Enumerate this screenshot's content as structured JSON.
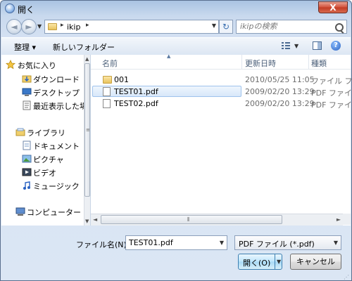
{
  "window": {
    "title": "開く",
    "close_glyph": "X"
  },
  "nav": {
    "back_glyph": "◄",
    "forward_glyph": "►",
    "dropdown_glyph": "▼"
  },
  "address": {
    "separator": "▸",
    "crumb": "ikip",
    "dropdown_glyph": "▼",
    "refresh_glyph": "↻"
  },
  "search": {
    "placeholder": "ikipの検索"
  },
  "toolbar": {
    "organize_label": "整理 ▾",
    "new_folder_label": "新しいフォルダー",
    "view_dropdown_glyph": "▼",
    "help_glyph": "?"
  },
  "navpane": {
    "items": [
      {
        "label": "お気に入り",
        "icon": "star-icon"
      },
      {
        "label": "ダウンロード",
        "icon": "download-folder-icon"
      },
      {
        "label": "デスクトップ",
        "icon": "desktop-icon"
      },
      {
        "label": "最近表示した場所",
        "icon": "recent-places-icon"
      },
      {
        "label": "ライブラリ",
        "icon": "library-icon"
      },
      {
        "label": "ドキュメント",
        "icon": "documents-icon"
      },
      {
        "label": "ピクチャ",
        "icon": "pictures-icon"
      },
      {
        "label": "ビデオ",
        "icon": "video-icon"
      },
      {
        "label": "ミュージック",
        "icon": "music-icon"
      },
      {
        "label": "コンピューター",
        "icon": "computer-icon"
      }
    ],
    "scroll_up": "▲",
    "scroll_down": "▼",
    "scroll_grip": "≡"
  },
  "filelist": {
    "columns": {
      "name": "名前",
      "date": "更新日時",
      "type": "種類"
    },
    "sort_arrow": "▲",
    "rows": [
      {
        "name": "001",
        "date": "2010/05/25 11:05",
        "type": "ファイル フ",
        "icon": "folder-icon"
      },
      {
        "name": "TEST01.pdf",
        "date": "2009/02/20 13:29",
        "type": "PDF ファイ",
        "icon": "pdf-file-icon",
        "selected": true
      },
      {
        "name": "TEST02.pdf",
        "date": "2009/02/20 13:29",
        "type": "PDF ファイ",
        "icon": "pdf-file-icon"
      }
    ],
    "hscroll_left": "◄",
    "hscroll_right": "►",
    "hscroll_grip": "⦀"
  },
  "bottom": {
    "filename_label": "ファイル名(N):",
    "filename_value": "TEST01.pdf",
    "filename_dropdown_glyph": "▼",
    "filetype_value": "PDF ファイル (*.pdf)",
    "filetype_dropdown_glyph": "▼",
    "open_label": "開く(O)",
    "open_dropdown_glyph": "▼",
    "cancel_label": "キャンセル",
    "resize_grip": "⋰"
  },
  "colors": {
    "accent": "#3c7fb1",
    "selection_fill": "#d8e8fa",
    "close_red": "#c23a24"
  }
}
